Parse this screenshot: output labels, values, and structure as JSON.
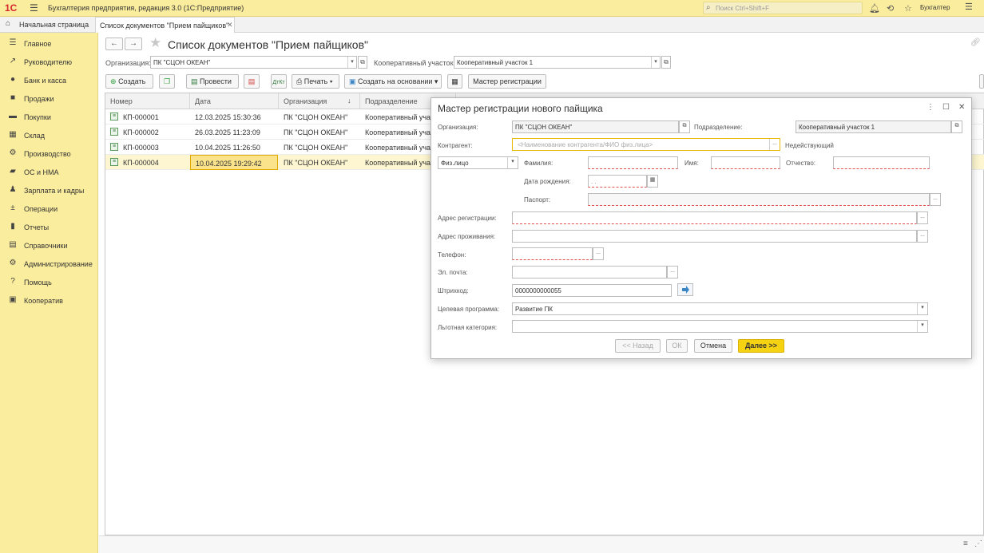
{
  "topbar": {
    "logo": "1С",
    "app_title": "Бухгалтерия предприятия, редакция 3.0  (1С:Предприятие)",
    "search_placeholder": "Поиск Ctrl+Shift+F",
    "user": "Бухгалтер"
  },
  "tabs": {
    "home_label": "Начальная страница",
    "active_tab": "Список документов \"Прием пайщиков\""
  },
  "sidebar": {
    "items": [
      {
        "label": "Главное",
        "icon": "menu-icon"
      },
      {
        "label": "Руководителю",
        "icon": "trend-icon"
      },
      {
        "label": "Банк и касса",
        "icon": "bank-icon"
      },
      {
        "label": "Продажи",
        "icon": "bag-icon"
      },
      {
        "label": "Покупки",
        "icon": "cart-icon"
      },
      {
        "label": "Склад",
        "icon": "warehouse-icon"
      },
      {
        "label": "Производство",
        "icon": "gear-icon"
      },
      {
        "label": "ОС и НМА",
        "icon": "truck-icon"
      },
      {
        "label": "Зарплата и кадры",
        "icon": "person-icon"
      },
      {
        "label": "Операции",
        "icon": "operations-icon"
      },
      {
        "label": "Отчеты",
        "icon": "chart-icon"
      },
      {
        "label": "Справочники",
        "icon": "book-icon"
      },
      {
        "label": "Администрирование",
        "icon": "admin-gear-icon"
      },
      {
        "label": "Помощь",
        "icon": "help-icon"
      },
      {
        "label": "Кооператив",
        "icon": "cooperative-icon"
      }
    ]
  },
  "main": {
    "title": "Список документов \"Прием пайщиков\"",
    "filters": {
      "org_label": "Организация:",
      "org_value": "ПК \"СЦОН ОКЕАН\"",
      "plot_label": "Кооперативный участок:",
      "plot_value": "Кооперативный участок 1"
    },
    "toolbar": {
      "create": "Создать",
      "post": "Провести",
      "print": "Печать",
      "create_based": "Создать на основании",
      "wizard": "Мастер регистрации"
    },
    "table": {
      "columns": [
        "Номер",
        "Дата",
        "Организация",
        "Подразделение"
      ],
      "rows": [
        [
          "КП-000001",
          "12.03.2025 15:30:36",
          "ПК \"СЦОН ОКЕАН\"",
          "Кооперативный уча..."
        ],
        [
          "КП-000002",
          "26.03.2025 11:23:09",
          "ПК \"СЦОН ОКЕАН\"",
          "Кооперативный уча..."
        ],
        [
          "КП-000003",
          "10.04.2025 11:26:50",
          "ПК \"СЦОН ОКЕАН\"",
          "Кооперативный уча..."
        ],
        [
          "КП-000004",
          "10.04.2025 19:29:42",
          "ПК \"СЦОН ОКЕАН\"",
          "Кооперативный уча..."
        ]
      ]
    }
  },
  "dialog": {
    "title": "Мастер регистрации нового пайщика",
    "org_label": "Организация:",
    "org_value": "ПК \"СЦОН ОКЕАН\"",
    "division_label": "Подразделение:",
    "division_value": "Кооперативный участок 1",
    "counterparty_label": "Контрагент:",
    "counterparty_placeholder": "<Наименование контрагента/ФИО физ.лица>",
    "inactive_label": "Недействующий",
    "person_type": "Физ.лицо",
    "surname_label": "Фамилия:",
    "name_label": "Имя:",
    "patronymic_label": "Отчество:",
    "birthdate_label": "Дата рождения:",
    "birthdate_value": "  .  .",
    "passport_label": "Паспорт:",
    "reg_address_label": "Адрес регистрации:",
    "live_address_label": "Адрес проживания:",
    "phone_label": "Телефон:",
    "email_label": "Эл. почта:",
    "barcode_label": "Штрихкод:",
    "barcode_value": "0000000000055",
    "program_label": "Целевая программа:",
    "program_value": "Развитие ПК",
    "benefit_label": "Льготная категория:",
    "back_btn": "<< Назад",
    "ok_btn": "ОК",
    "cancel_btn": "Отмена",
    "next_btn": "Далее >>"
  }
}
